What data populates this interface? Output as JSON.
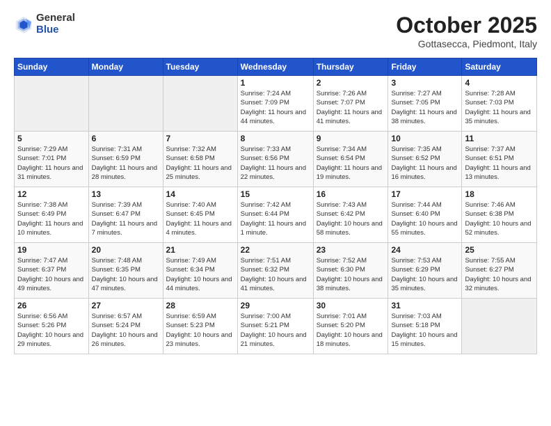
{
  "logo": {
    "general": "General",
    "blue": "Blue"
  },
  "title": "October 2025",
  "location": "Gottasecca, Piedmont, Italy",
  "weekdays": [
    "Sunday",
    "Monday",
    "Tuesday",
    "Wednesday",
    "Thursday",
    "Friday",
    "Saturday"
  ],
  "weeks": [
    [
      {
        "day": "",
        "info": ""
      },
      {
        "day": "",
        "info": ""
      },
      {
        "day": "",
        "info": ""
      },
      {
        "day": "1",
        "info": "Sunrise: 7:24 AM\nSunset: 7:09 PM\nDaylight: 11 hours\nand 44 minutes."
      },
      {
        "day": "2",
        "info": "Sunrise: 7:26 AM\nSunset: 7:07 PM\nDaylight: 11 hours\nand 41 minutes."
      },
      {
        "day": "3",
        "info": "Sunrise: 7:27 AM\nSunset: 7:05 PM\nDaylight: 11 hours\nand 38 minutes."
      },
      {
        "day": "4",
        "info": "Sunrise: 7:28 AM\nSunset: 7:03 PM\nDaylight: 11 hours\nand 35 minutes."
      }
    ],
    [
      {
        "day": "5",
        "info": "Sunrise: 7:29 AM\nSunset: 7:01 PM\nDaylight: 11 hours\nand 31 minutes."
      },
      {
        "day": "6",
        "info": "Sunrise: 7:31 AM\nSunset: 6:59 PM\nDaylight: 11 hours\nand 28 minutes."
      },
      {
        "day": "7",
        "info": "Sunrise: 7:32 AM\nSunset: 6:58 PM\nDaylight: 11 hours\nand 25 minutes."
      },
      {
        "day": "8",
        "info": "Sunrise: 7:33 AM\nSunset: 6:56 PM\nDaylight: 11 hours\nand 22 minutes."
      },
      {
        "day": "9",
        "info": "Sunrise: 7:34 AM\nSunset: 6:54 PM\nDaylight: 11 hours\nand 19 minutes."
      },
      {
        "day": "10",
        "info": "Sunrise: 7:35 AM\nSunset: 6:52 PM\nDaylight: 11 hours\nand 16 minutes."
      },
      {
        "day": "11",
        "info": "Sunrise: 7:37 AM\nSunset: 6:51 PM\nDaylight: 11 hours\nand 13 minutes."
      }
    ],
    [
      {
        "day": "12",
        "info": "Sunrise: 7:38 AM\nSunset: 6:49 PM\nDaylight: 11 hours\nand 10 minutes."
      },
      {
        "day": "13",
        "info": "Sunrise: 7:39 AM\nSunset: 6:47 PM\nDaylight: 11 hours\nand 7 minutes."
      },
      {
        "day": "14",
        "info": "Sunrise: 7:40 AM\nSunset: 6:45 PM\nDaylight: 11 hours\nand 4 minutes."
      },
      {
        "day": "15",
        "info": "Sunrise: 7:42 AM\nSunset: 6:44 PM\nDaylight: 11 hours\nand 1 minute."
      },
      {
        "day": "16",
        "info": "Sunrise: 7:43 AM\nSunset: 6:42 PM\nDaylight: 10 hours\nand 58 minutes."
      },
      {
        "day": "17",
        "info": "Sunrise: 7:44 AM\nSunset: 6:40 PM\nDaylight: 10 hours\nand 55 minutes."
      },
      {
        "day": "18",
        "info": "Sunrise: 7:46 AM\nSunset: 6:38 PM\nDaylight: 10 hours\nand 52 minutes."
      }
    ],
    [
      {
        "day": "19",
        "info": "Sunrise: 7:47 AM\nSunset: 6:37 PM\nDaylight: 10 hours\nand 49 minutes."
      },
      {
        "day": "20",
        "info": "Sunrise: 7:48 AM\nSunset: 6:35 PM\nDaylight: 10 hours\nand 47 minutes."
      },
      {
        "day": "21",
        "info": "Sunrise: 7:49 AM\nSunset: 6:34 PM\nDaylight: 10 hours\nand 44 minutes."
      },
      {
        "day": "22",
        "info": "Sunrise: 7:51 AM\nSunset: 6:32 PM\nDaylight: 10 hours\nand 41 minutes."
      },
      {
        "day": "23",
        "info": "Sunrise: 7:52 AM\nSunset: 6:30 PM\nDaylight: 10 hours\nand 38 minutes."
      },
      {
        "day": "24",
        "info": "Sunrise: 7:53 AM\nSunset: 6:29 PM\nDaylight: 10 hours\nand 35 minutes."
      },
      {
        "day": "25",
        "info": "Sunrise: 7:55 AM\nSunset: 6:27 PM\nDaylight: 10 hours\nand 32 minutes."
      }
    ],
    [
      {
        "day": "26",
        "info": "Sunrise: 6:56 AM\nSunset: 5:26 PM\nDaylight: 10 hours\nand 29 minutes."
      },
      {
        "day": "27",
        "info": "Sunrise: 6:57 AM\nSunset: 5:24 PM\nDaylight: 10 hours\nand 26 minutes."
      },
      {
        "day": "28",
        "info": "Sunrise: 6:59 AM\nSunset: 5:23 PM\nDaylight: 10 hours\nand 23 minutes."
      },
      {
        "day": "29",
        "info": "Sunrise: 7:00 AM\nSunset: 5:21 PM\nDaylight: 10 hours\nand 21 minutes."
      },
      {
        "day": "30",
        "info": "Sunrise: 7:01 AM\nSunset: 5:20 PM\nDaylight: 10 hours\nand 18 minutes."
      },
      {
        "day": "31",
        "info": "Sunrise: 7:03 AM\nSunset: 5:18 PM\nDaylight: 10 hours\nand 15 minutes."
      },
      {
        "day": "",
        "info": ""
      }
    ]
  ]
}
